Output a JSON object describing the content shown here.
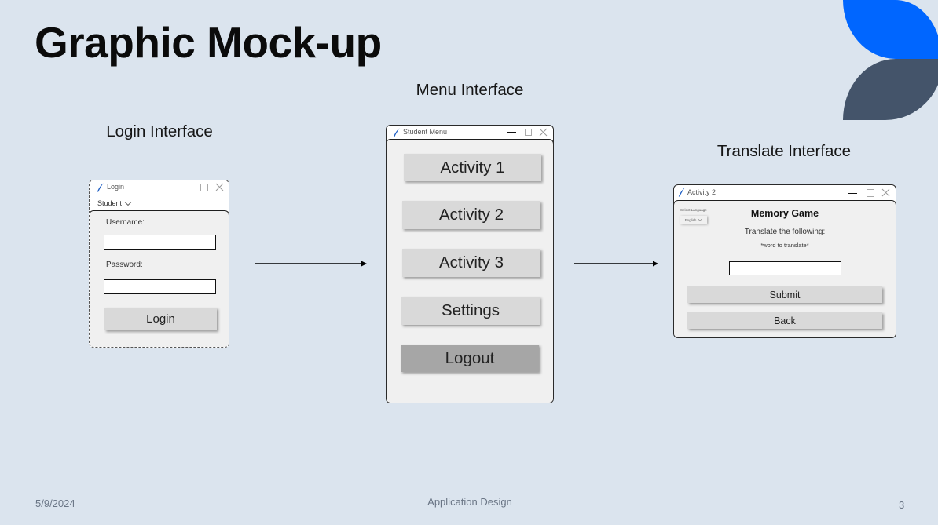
{
  "slide": {
    "title": "Graphic Mock-up",
    "colors": {
      "background": "#dbe4ee",
      "accent_blue": "#0066ff",
      "accent_slate": "#44546a"
    }
  },
  "sections": {
    "login_heading": "Login Interface",
    "menu_heading": "Menu Interface",
    "translate_heading": "Translate Interface"
  },
  "icons": {
    "app": "feather-icon",
    "minimize": "minimize-icon",
    "maximize": "maximize-icon",
    "close": "close-icon",
    "dropdown": "chevron-down-icon",
    "flow": "arrow-right-icon"
  },
  "login_window": {
    "title": "Login",
    "role_menu": "Student",
    "username_label": "Username:",
    "username_value": "",
    "password_label": "Password:",
    "password_value": "",
    "login_button": "Login"
  },
  "menu_window": {
    "title": "Student Menu",
    "buttons": [
      {
        "label": "Activity 1"
      },
      {
        "label": "Activity 2"
      },
      {
        "label": "Activity 3"
      },
      {
        "label": "Settings"
      },
      {
        "label": "Logout"
      }
    ]
  },
  "translate_window": {
    "title": "Activity 2",
    "select_language_label": "Select Language",
    "language": "English",
    "heading": "Memory Game",
    "prompt": "Translate the following:",
    "word": "*word to translate*",
    "answer_value": "",
    "submit_button": "Submit",
    "back_button": "Back"
  },
  "footer": {
    "date": "5/9/2024",
    "center": "Application Design",
    "page_number": "3"
  }
}
